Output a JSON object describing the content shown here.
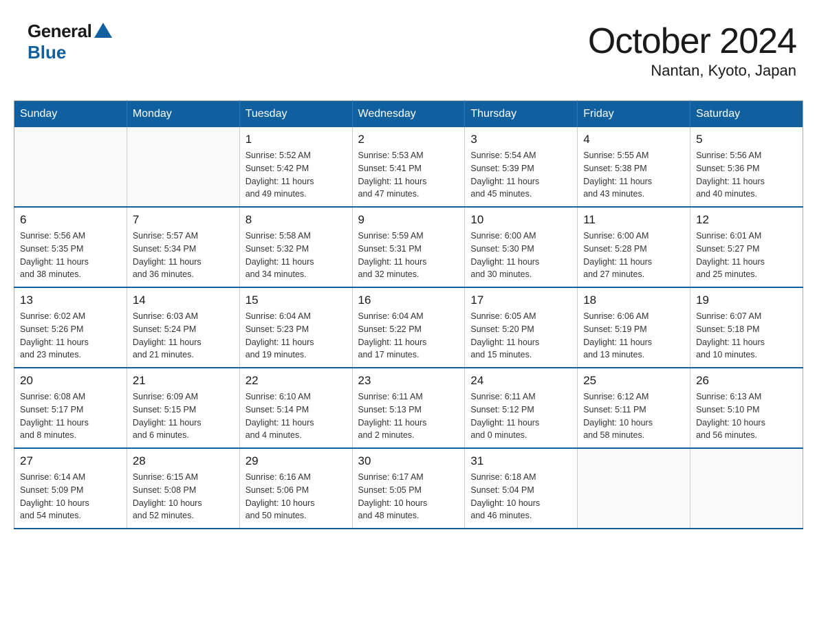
{
  "header": {
    "logo_general": "General",
    "logo_blue": "Blue",
    "title": "October 2024",
    "subtitle": "Nantan, Kyoto, Japan"
  },
  "days_of_week": [
    "Sunday",
    "Monday",
    "Tuesday",
    "Wednesday",
    "Thursday",
    "Friday",
    "Saturday"
  ],
  "weeks": [
    [
      {
        "day": "",
        "info": ""
      },
      {
        "day": "",
        "info": ""
      },
      {
        "day": "1",
        "info": "Sunrise: 5:52 AM\nSunset: 5:42 PM\nDaylight: 11 hours\nand 49 minutes."
      },
      {
        "day": "2",
        "info": "Sunrise: 5:53 AM\nSunset: 5:41 PM\nDaylight: 11 hours\nand 47 minutes."
      },
      {
        "day": "3",
        "info": "Sunrise: 5:54 AM\nSunset: 5:39 PM\nDaylight: 11 hours\nand 45 minutes."
      },
      {
        "day": "4",
        "info": "Sunrise: 5:55 AM\nSunset: 5:38 PM\nDaylight: 11 hours\nand 43 minutes."
      },
      {
        "day": "5",
        "info": "Sunrise: 5:56 AM\nSunset: 5:36 PM\nDaylight: 11 hours\nand 40 minutes."
      }
    ],
    [
      {
        "day": "6",
        "info": "Sunrise: 5:56 AM\nSunset: 5:35 PM\nDaylight: 11 hours\nand 38 minutes."
      },
      {
        "day": "7",
        "info": "Sunrise: 5:57 AM\nSunset: 5:34 PM\nDaylight: 11 hours\nand 36 minutes."
      },
      {
        "day": "8",
        "info": "Sunrise: 5:58 AM\nSunset: 5:32 PM\nDaylight: 11 hours\nand 34 minutes."
      },
      {
        "day": "9",
        "info": "Sunrise: 5:59 AM\nSunset: 5:31 PM\nDaylight: 11 hours\nand 32 minutes."
      },
      {
        "day": "10",
        "info": "Sunrise: 6:00 AM\nSunset: 5:30 PM\nDaylight: 11 hours\nand 30 minutes."
      },
      {
        "day": "11",
        "info": "Sunrise: 6:00 AM\nSunset: 5:28 PM\nDaylight: 11 hours\nand 27 minutes."
      },
      {
        "day": "12",
        "info": "Sunrise: 6:01 AM\nSunset: 5:27 PM\nDaylight: 11 hours\nand 25 minutes."
      }
    ],
    [
      {
        "day": "13",
        "info": "Sunrise: 6:02 AM\nSunset: 5:26 PM\nDaylight: 11 hours\nand 23 minutes."
      },
      {
        "day": "14",
        "info": "Sunrise: 6:03 AM\nSunset: 5:24 PM\nDaylight: 11 hours\nand 21 minutes."
      },
      {
        "day": "15",
        "info": "Sunrise: 6:04 AM\nSunset: 5:23 PM\nDaylight: 11 hours\nand 19 minutes."
      },
      {
        "day": "16",
        "info": "Sunrise: 6:04 AM\nSunset: 5:22 PM\nDaylight: 11 hours\nand 17 minutes."
      },
      {
        "day": "17",
        "info": "Sunrise: 6:05 AM\nSunset: 5:20 PM\nDaylight: 11 hours\nand 15 minutes."
      },
      {
        "day": "18",
        "info": "Sunrise: 6:06 AM\nSunset: 5:19 PM\nDaylight: 11 hours\nand 13 minutes."
      },
      {
        "day": "19",
        "info": "Sunrise: 6:07 AM\nSunset: 5:18 PM\nDaylight: 11 hours\nand 10 minutes."
      }
    ],
    [
      {
        "day": "20",
        "info": "Sunrise: 6:08 AM\nSunset: 5:17 PM\nDaylight: 11 hours\nand 8 minutes."
      },
      {
        "day": "21",
        "info": "Sunrise: 6:09 AM\nSunset: 5:15 PM\nDaylight: 11 hours\nand 6 minutes."
      },
      {
        "day": "22",
        "info": "Sunrise: 6:10 AM\nSunset: 5:14 PM\nDaylight: 11 hours\nand 4 minutes."
      },
      {
        "day": "23",
        "info": "Sunrise: 6:11 AM\nSunset: 5:13 PM\nDaylight: 11 hours\nand 2 minutes."
      },
      {
        "day": "24",
        "info": "Sunrise: 6:11 AM\nSunset: 5:12 PM\nDaylight: 11 hours\nand 0 minutes."
      },
      {
        "day": "25",
        "info": "Sunrise: 6:12 AM\nSunset: 5:11 PM\nDaylight: 10 hours\nand 58 minutes."
      },
      {
        "day": "26",
        "info": "Sunrise: 6:13 AM\nSunset: 5:10 PM\nDaylight: 10 hours\nand 56 minutes."
      }
    ],
    [
      {
        "day": "27",
        "info": "Sunrise: 6:14 AM\nSunset: 5:09 PM\nDaylight: 10 hours\nand 54 minutes."
      },
      {
        "day": "28",
        "info": "Sunrise: 6:15 AM\nSunset: 5:08 PM\nDaylight: 10 hours\nand 52 minutes."
      },
      {
        "day": "29",
        "info": "Sunrise: 6:16 AM\nSunset: 5:06 PM\nDaylight: 10 hours\nand 50 minutes."
      },
      {
        "day": "30",
        "info": "Sunrise: 6:17 AM\nSunset: 5:05 PM\nDaylight: 10 hours\nand 48 minutes."
      },
      {
        "day": "31",
        "info": "Sunrise: 6:18 AM\nSunset: 5:04 PM\nDaylight: 10 hours\nand 46 minutes."
      },
      {
        "day": "",
        "info": ""
      },
      {
        "day": "",
        "info": ""
      }
    ]
  ]
}
